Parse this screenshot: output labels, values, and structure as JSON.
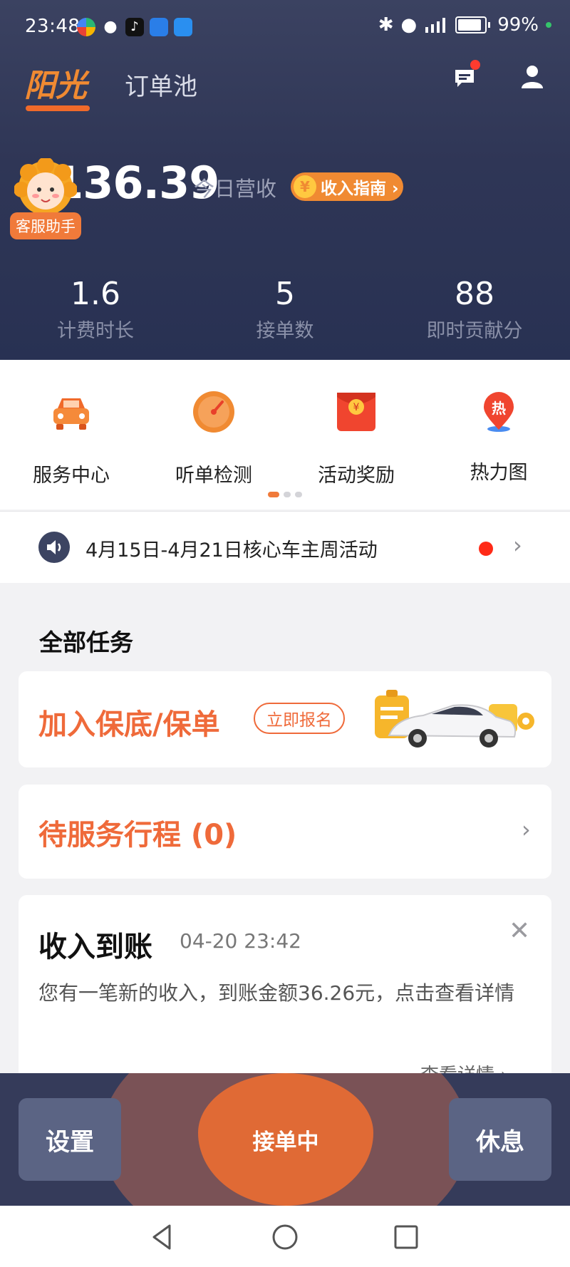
{
  "statusbar": {
    "time": "23:48",
    "battery": "99%",
    "apps": [
      "browser-app-icon",
      "wechat-app-icon",
      "douyin-app-icon",
      "hello-app-icon",
      "navigation-app-icon"
    ]
  },
  "topnav": {
    "brand": "阳光",
    "tab_orderpool": "订单池"
  },
  "earnings": {
    "amount": "¥136.39",
    "label": "今日营收",
    "guide_button": "收入指南 ›",
    "cs_tag": "客服助手"
  },
  "stats": [
    {
      "value": "1.6",
      "label": "计费时长"
    },
    {
      "value": "5",
      "label": "接单数"
    },
    {
      "value": "88",
      "label": "即时贡献分"
    }
  ],
  "quick_menu": [
    {
      "label": "服务中心",
      "icon": "car-icon"
    },
    {
      "label": "听单检测",
      "icon": "gauge-icon"
    },
    {
      "label": "活动奖励",
      "icon": "red-envelope-icon"
    },
    {
      "label": "热力图",
      "icon": "heatmap-pin-icon",
      "badge": "热"
    }
  ],
  "notice": {
    "text": "4月15日-4月21日核心车主周活动"
  },
  "section_title": "全部任务",
  "promo": {
    "title": "加入保底/保单",
    "button": "立即报名"
  },
  "pending": {
    "title": "待服务行程 (0)"
  },
  "income": {
    "title": "收入到账",
    "time": "04-20 23:42",
    "body": "您有一笔新的收入，到账金额36.26元，点击查看详情",
    "view_details": "查看详情"
  },
  "actions": {
    "settings": "设置",
    "accepting": "接单中",
    "rest": "休息"
  },
  "colors": {
    "brand_orange": "#ef6a3a",
    "header_dark": "#2f3656",
    "notice_red": "#ff2a17"
  }
}
